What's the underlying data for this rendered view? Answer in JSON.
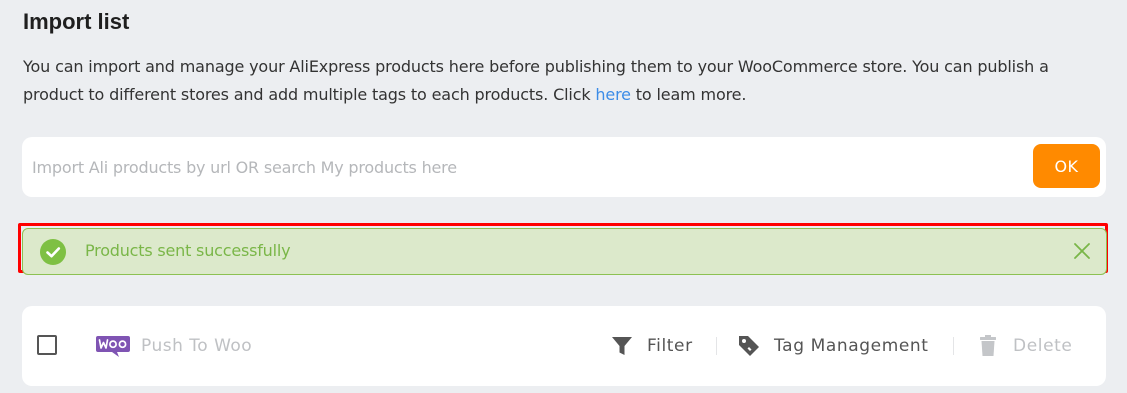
{
  "header": {
    "title": "Import list",
    "description_before_link": "You can import and manage your AliExpress products here before publishing them to your WooCommerce store. You can publish a product to different stores and add multiple tags to each products. Click ",
    "link_text": "here",
    "description_after_link": " to leam more."
  },
  "search": {
    "placeholder": "Import Ali products by url OR search My products here",
    "value": "",
    "ok_label": "OK"
  },
  "alert": {
    "message": "Products sent successfully",
    "close_label": "X"
  },
  "toolbar": {
    "push_label": "Push To Woo",
    "filter_label": "Filter",
    "tag_label": "Tag Management",
    "delete_label": "Delete"
  },
  "colors": {
    "accent": "#ff8a00",
    "success_bg": "#dce9cb",
    "success_text": "#7ab648",
    "link": "#3c8ce7",
    "highlight_outline": "#ff0000",
    "woo_purple": "#7f54b3"
  },
  "icons": {
    "alert": "check-circle-icon",
    "close": "close-icon",
    "push": "woo-logo-icon",
    "filter": "funnel-icon",
    "tag": "tag-icon",
    "delete": "trash-icon"
  }
}
